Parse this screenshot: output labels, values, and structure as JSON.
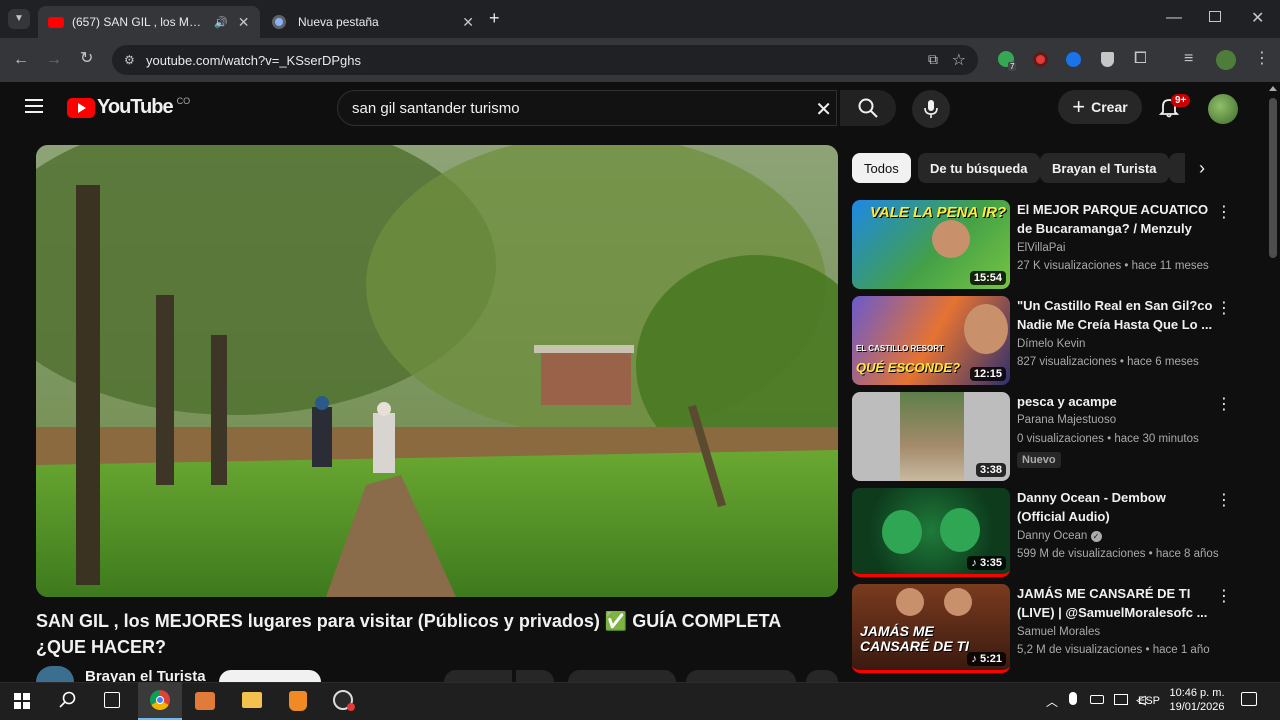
{
  "browser": {
    "tabs": [
      {
        "title": "(657) SAN GIL , los MEJORES",
        "active": true
      },
      {
        "title": "Nueva pestaña",
        "active": false
      }
    ],
    "new_tab": "+",
    "url": "youtube.com/watch?v=_KSserDPghs",
    "extensions_count": "7"
  },
  "youtube": {
    "logo_text": "YouTube",
    "country_code": "CO",
    "search_query": "san gil santander turismo",
    "create_label": "Crear",
    "notifications_badge": "9+"
  },
  "video": {
    "title": "SAN GIL , los MEJORES lugares para visitar (Públicos y privados) ✅ GUÍA COMPLETA ¿QUE HACER?",
    "channel": "Brayan el Turista"
  },
  "chips": [
    "Todos",
    "De tu búsqueda",
    "Brayan el Turista"
  ],
  "recommendations": [
    {
      "title": "El MEJOR PARQUE ACUATICO de Bucaramanga? / Menzuly",
      "channel": "ElVillaPai",
      "meta": "27 K visualizaciones • hace 11 meses",
      "duration": "15:54",
      "thumb_text": "VALE LA PENA IR?"
    },
    {
      "title": "\"Un Castillo Real en San Gil?co Nadie Me Creía Hasta Que Lo ...",
      "channel": "Dímelo Kevin",
      "meta": "827 visualizaciones • hace 6 meses",
      "duration": "12:15",
      "thumb_text": "QUÉ ESCONDE?",
      "thumb_text2": "EL CASTILLO RESORT"
    },
    {
      "title": "pesca y acampe",
      "channel": "Parana Majestuoso",
      "meta": "0 visualizaciones • hace 30 minutos",
      "duration": "3:38",
      "badge": "Nuevo"
    },
    {
      "title": "Danny Ocean - Dembow (Official Audio)",
      "channel": "Danny Ocean",
      "meta": "599 M de visualizaciones • hace 8 años",
      "duration": "3:35"
    },
    {
      "title": "JAMÁS ME CANSARÉ DE TI (LIVE) | @SamuelMoralesofc ...",
      "channel": "Samuel Morales",
      "meta": "5,2 M de visualizaciones • hace 1 año",
      "duration": "5:21",
      "thumb_text": "JAMÁS ME CANSARÉ DE TI"
    }
  ],
  "taskbar": {
    "lang": "ESP",
    "time": "10:46 p. m.",
    "date": "19/01/2026"
  },
  "colors": {
    "yt_red": "#ff0000",
    "bg": "#0f0f0f",
    "chrome_dark": "#202124",
    "chrome_toolbar": "#35363a"
  }
}
